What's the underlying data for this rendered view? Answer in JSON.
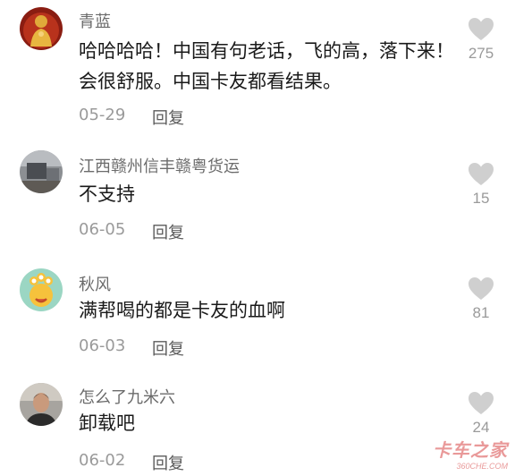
{
  "comments": [
    {
      "username": "青蓝",
      "lines": [
        "哈哈哈哈！中国有句老话，飞的高，落下来！",
        "会很舒服。中国卡友都看结果。"
      ],
      "date": "05-29",
      "reply": "回复",
      "likes": "275"
    },
    {
      "username": "江西赣州信丰赣粤货运",
      "lines": [
        "不支持"
      ],
      "date": "06-05",
      "reply": "回复",
      "likes": "15"
    },
    {
      "username": "秋风",
      "lines": [
        "满帮喝的都是卡友的血啊"
      ],
      "date": "06-03",
      "reply": "回复",
      "likes": "81"
    },
    {
      "username": "怎么了九米六",
      "lines": [
        "卸载吧"
      ],
      "date": "06-02",
      "reply": "回复",
      "likes": "24"
    }
  ],
  "watermark": {
    "cn": "卡车之家",
    "en": "360CHE.COM"
  },
  "colors": {
    "heart": "#cfcfcf",
    "username": "#6b6b6b",
    "text": "#1a1a1a",
    "meta": "#9a9a9a"
  }
}
